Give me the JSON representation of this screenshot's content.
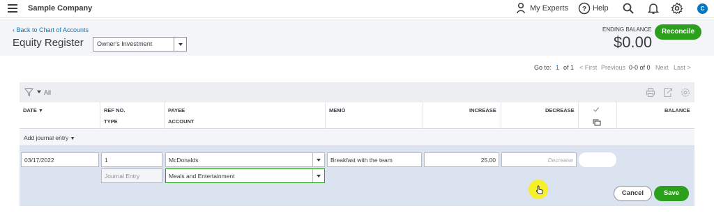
{
  "topbar": {
    "company_name": "Sample Company",
    "my_experts_label": "My Experts",
    "help_label": "Help",
    "avatar_initial": "C"
  },
  "header": {
    "back_link": "Back to Chart of Accounts",
    "title": "Equity Register",
    "account_selected": "Owner's Investment",
    "ending_balance_label": "ENDING BALANCE",
    "ending_balance_value": "$0.00",
    "reconcile_label": "Reconcile"
  },
  "pagination": {
    "goto_label": "Go to:",
    "page_current": "1",
    "page_of": "of 1",
    "first_label": "< First",
    "previous_label": "Previous",
    "range_label": "0-0 of 0",
    "next_label": "Next",
    "last_label": "Last >"
  },
  "filter": {
    "all_label": "All"
  },
  "columns": {
    "date": "DATE",
    "ref_no": "REF NO.",
    "type": "TYPE",
    "payee": "PAYEE",
    "account": "ACCOUNT",
    "memo": "MEMO",
    "increase": "INCREASE",
    "decrease": "DECREASE",
    "balance": "BALANCE"
  },
  "add_row": {
    "label": "Add journal entry"
  },
  "edit_row": {
    "date": "03/17/2022",
    "ref_no": "1",
    "payee": "McDonalds",
    "memo": "Breakfast with the team",
    "increase": "25.00",
    "decrease_placeholder": "Decrease",
    "type": "Journal Entry",
    "account": "Meals and Entertainment"
  },
  "actions": {
    "cancel_label": "Cancel",
    "save_label": "Save"
  },
  "colors": {
    "accent_green": "#2ca01c",
    "link_blue": "#0077c5",
    "edit_row_bg": "#dae3ef",
    "cursor_highlight": "#f5f02a"
  }
}
